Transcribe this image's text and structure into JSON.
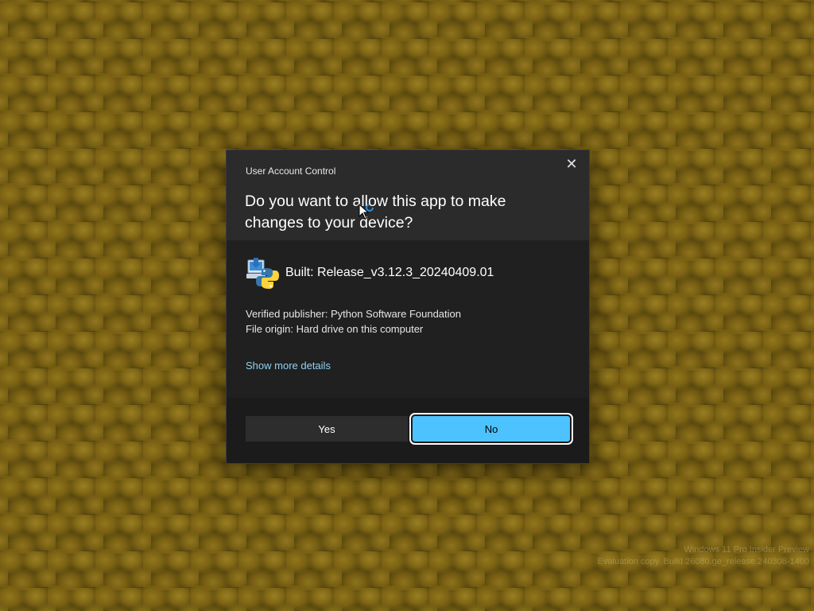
{
  "desktop": {
    "watermark_line1": "Windows 11 Pro Insider Preview",
    "watermark_line2": "Evaluation copy. Build 26080.ge_release.240308-1400"
  },
  "uac": {
    "title": "User Account Control",
    "close_glyph": "✕",
    "question": "Do you want to allow this app to make changes to your device?",
    "app_name": "Built: Release_v3.12.3_20240409.01",
    "app_icon": "python-installer-icon",
    "publisher": "Verified publisher: Python Software Foundation",
    "file_origin": "File origin: Hard drive on this computer",
    "more_details": "Show more details",
    "yes_label": "Yes",
    "no_label": "No"
  },
  "colors": {
    "dialog_bg": "#202020",
    "header_bg": "#2b2b2b",
    "accent": "#4cc2ff",
    "link": "#8fd3f5"
  }
}
